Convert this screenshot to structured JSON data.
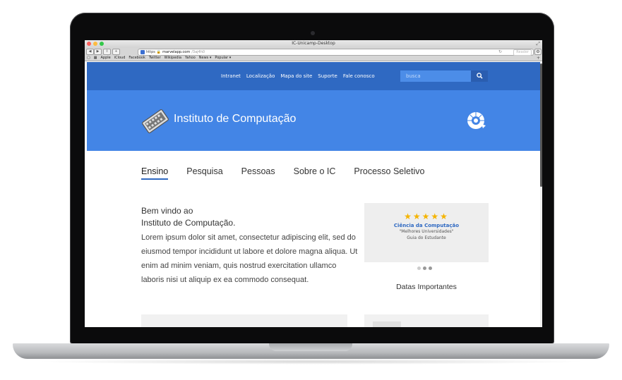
{
  "browser": {
    "window_title": "IC-Unicamp-Desktop",
    "url_prefix": "https",
    "url_domain": "marvelapp.com",
    "url_path": "/3aj4h0",
    "reader_label": "Reader",
    "bookmarks": [
      "Apple",
      "iCloud",
      "Facebook",
      "Twitter",
      "Wikipedia",
      "Yahoo",
      "News ▾",
      "Popular ▾"
    ]
  },
  "topnav": {
    "links": [
      "Intranet",
      "Localização",
      "Mapa do site",
      "Suporte",
      "Fale conosco"
    ],
    "search_placeholder": "busca"
  },
  "header": {
    "institute_name": "Instituto de Computação"
  },
  "mainnav": {
    "items": [
      "Ensino",
      "Pesquisa",
      "Pessoas",
      "Sobre o IC",
      "Processo Seletivo"
    ],
    "active": "Ensino"
  },
  "welcome": {
    "line1": "Bem vindo ao",
    "line2": "Instituto de Computação.",
    "body": "Lorem ipsum dolor sit amet, consectetur adipiscing elit, sed do eiusmod tempor incididunt ut labore et dolore magna aliqua. Ut enim ad minim veniam, quis nostrud exercitation ullamco laboris nisi ut aliquip ex ea commodo consequat."
  },
  "ranking": {
    "stars": "★★★★★",
    "rating": 5,
    "title": "Ciência da Computação",
    "line1": "\"Melhores Universidades\"",
    "line2": "Guia do Estudante"
  },
  "sidebar": {
    "heading": "Datas Importantes"
  },
  "colors": {
    "nav_blue": "#2f69c2",
    "hero_blue": "#4385e6",
    "star_gold": "#f5b400"
  }
}
